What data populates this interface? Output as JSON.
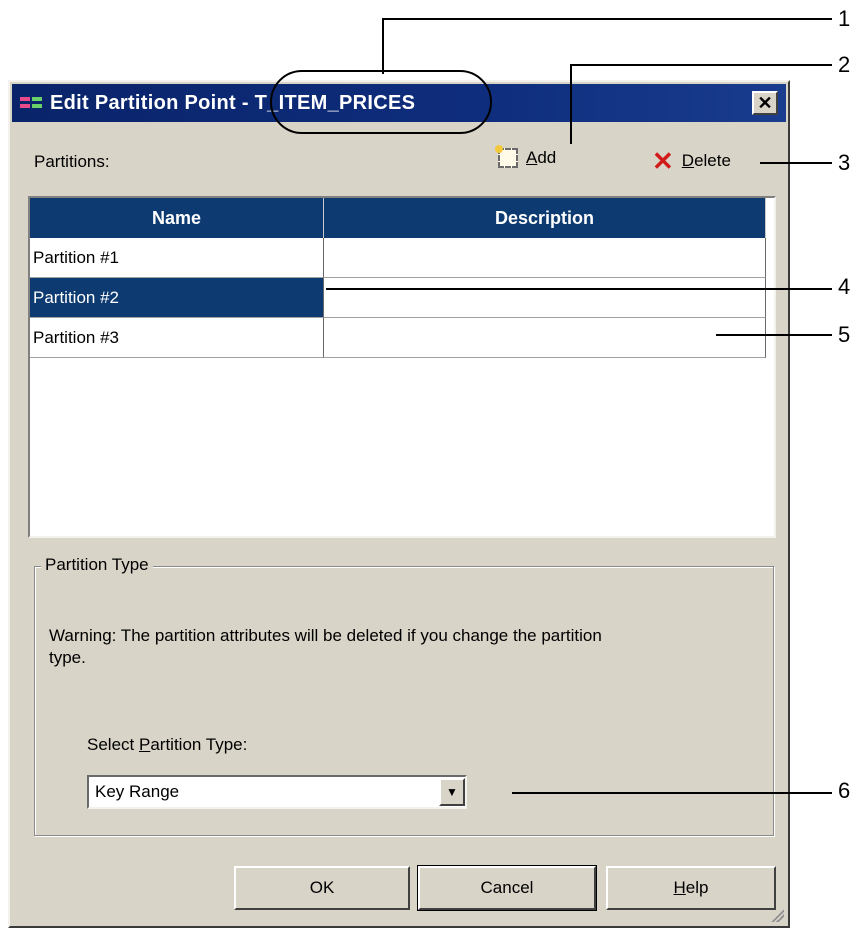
{
  "dialog": {
    "title": "Edit Partition Point - T_ITEM_PRICES",
    "close_symbol": "✕"
  },
  "toolbar": {
    "partitions_label": "Partitions:",
    "add_label_ul": "A",
    "add_label_rest": "dd",
    "delete_label_ul": "D",
    "delete_label_rest": "elete",
    "add_icon": "add-partition-icon",
    "delete_icon": "delete-x-icon"
  },
  "grid": {
    "columns": [
      "Name",
      "Description"
    ],
    "rows": [
      {
        "name": "Partition #1",
        "description": ""
      },
      {
        "name": "Partition #2",
        "description": ""
      },
      {
        "name": "Partition #3",
        "description": ""
      }
    ]
  },
  "partition_type": {
    "legend": "Partition Type",
    "warning": "Warning: The partition attributes will be deleted if you change the partition type.",
    "select_label_pre": "Select ",
    "select_label_ul": "P",
    "select_label_post": "artition Type:",
    "selected_value": "Key Range"
  },
  "buttons": {
    "ok": "OK",
    "cancel": "Cancel",
    "help_ul": "H",
    "help_rest": "elp"
  },
  "callouts": [
    "1",
    "2",
    "3",
    "4",
    "5",
    "6"
  ]
}
